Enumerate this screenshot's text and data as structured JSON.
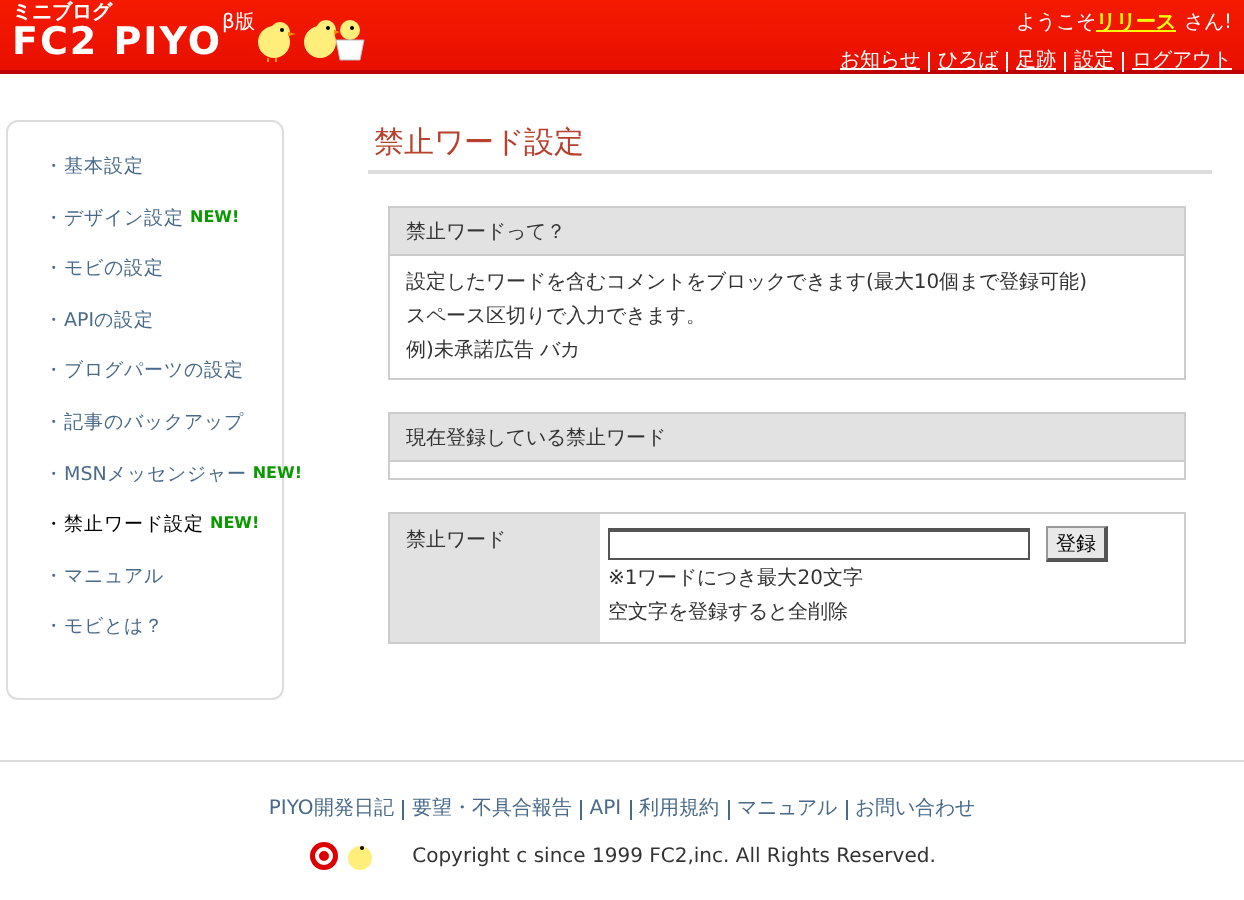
{
  "header": {
    "logo_small": "ミニブログ",
    "logo": "FC2 PIYO",
    "beta": "β版",
    "welcome_prefix": "ようこそ",
    "user": "リリース",
    "welcome_suffix": "さん!",
    "nav": [
      "お知らせ",
      "ひろば",
      "足跡",
      "設定",
      "ログアウト"
    ]
  },
  "sidebar": {
    "items": [
      {
        "label": "・基本設定",
        "selected": false
      },
      {
        "label": "・デザイン設定",
        "selected": false,
        "badge": "NEW!"
      },
      {
        "label": "・モビの設定",
        "selected": false
      },
      {
        "label": "・APIの設定",
        "selected": false
      },
      {
        "label": "・ブログパーツの設定",
        "selected": false
      },
      {
        "label": "・記事のバックアップ",
        "selected": false
      },
      {
        "label": "・MSNメッセンジャー",
        "selected": false,
        "badge": "NEW!"
      },
      {
        "label": "・禁止ワード設定",
        "selected": true,
        "badge": "NEW!"
      },
      {
        "label": "・マニュアル",
        "selected": false
      },
      {
        "label": "・モビとは？",
        "selected": false
      }
    ]
  },
  "page_title": "禁止ワード設定",
  "info_box": {
    "heading": "禁止ワードって？",
    "lines": [
      "設定したワードを含むコメントをブロックできます(最大10個まで登録可能)",
      "スペース区切りで入力できます。",
      "例)未承諾広告 バカ"
    ]
  },
  "registered_box": {
    "heading": "現在登録している禁止ワード"
  },
  "form": {
    "label": "禁止ワード",
    "button": "登録",
    "notes": [
      "※1ワードにつき最大20文字",
      "空文字を登録すると全削除"
    ]
  },
  "footer": {
    "links": [
      "PIYO開発日記",
      "要望・不具合報告",
      "API",
      "利用規約",
      "マニュアル",
      "お問い合わせ"
    ],
    "copyright": "Copyright c since 1999 FC2,inc. All Rights Reserved."
  }
}
